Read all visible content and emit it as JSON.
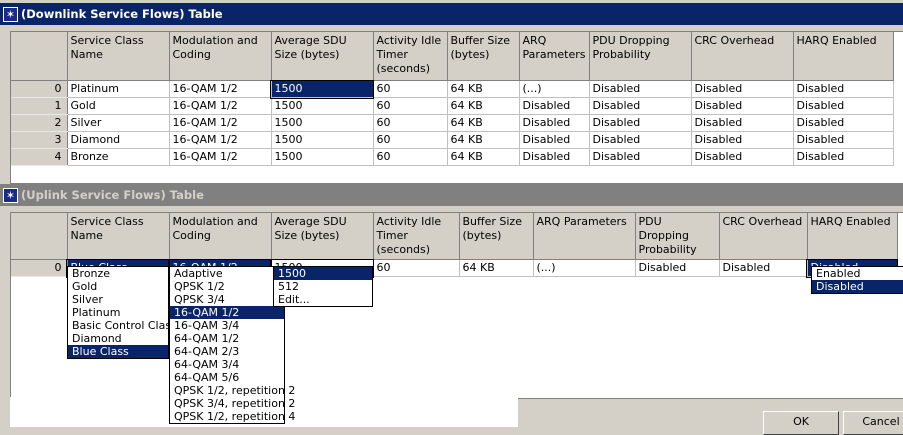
{
  "downlink": {
    "title": "(Downlink Service Flows) Table",
    "columns": [
      "Service Class Name",
      "Modulation and Coding",
      "Average SDU Size (bytes)",
      "Activity Idle Timer (seconds)",
      "Buffer Size (bytes)",
      "ARQ Parameters",
      "PDU Dropping Probability",
      "CRC Overhead",
      "HARQ Enabled"
    ],
    "rows": [
      {
        "index": "0",
        "cells": [
          "Platinum",
          "16-QAM 1/2",
          "1500",
          "60",
          "64 KB",
          "(...)",
          "Disabled",
          "Disabled",
          "Disabled"
        ]
      },
      {
        "index": "1",
        "cells": [
          "Gold",
          "16-QAM 1/2",
          "1500",
          "60",
          "64 KB",
          "Disabled",
          "Disabled",
          "Disabled",
          "Disabled"
        ]
      },
      {
        "index": "2",
        "cells": [
          "Silver",
          "16-QAM 1/2",
          "1500",
          "60",
          "64 KB",
          "Disabled",
          "Disabled",
          "Disabled",
          "Disabled"
        ]
      },
      {
        "index": "3",
        "cells": [
          "Diamond",
          "16-QAM 1/2",
          "1500",
          "60",
          "64 KB",
          "Disabled",
          "Disabled",
          "Disabled",
          "Disabled"
        ]
      },
      {
        "index": "4",
        "cells": [
          "Bronze",
          "16-QAM 1/2",
          "1500",
          "60",
          "64 KB",
          "Disabled",
          "Disabled",
          "Disabled",
          "Disabled"
        ]
      }
    ]
  },
  "uplink": {
    "title": "(Uplink Service Flows) Table",
    "columns": [
      "Service Class Name",
      "Modulation and Coding",
      "Average SDU Size (bytes)",
      "Activity Idle Timer (seconds)",
      "Buffer Size (bytes)",
      "ARQ Parameters",
      "PDU Dropping Probability",
      "CRC Overhead",
      "HARQ Enabled"
    ],
    "rows": [
      {
        "index": "0",
        "cells": [
          "Blue Class",
          "16-QAM 1/2",
          "1500",
          "60",
          "64 KB",
          "(...)",
          "Disabled",
          "Disabled",
          "Disabled"
        ]
      }
    ]
  },
  "dropdowns": {
    "service_class": [
      "Bronze",
      "Gold",
      "Silver",
      "Platinum",
      "Basic Control Class",
      "Diamond",
      "Blue Class"
    ],
    "service_class_selected": "Blue Class",
    "modulation": [
      "Adaptive",
      "QPSK 1/2",
      "QPSK 3/4",
      "16-QAM 1/2",
      "16-QAM 3/4",
      "64-QAM 1/2",
      "64-QAM 2/3",
      "64-QAM 3/4",
      "64-QAM 5/6",
      "QPSK 1/2, repetition 2",
      "QPSK 3/4, repetition 2",
      "QPSK 1/2, repetition 4"
    ],
    "modulation_selected": "16-QAM 1/2",
    "sdu_size": [
      "1500",
      "512",
      "Edit..."
    ],
    "sdu_size_selected": "1500",
    "harq": [
      "Enabled",
      "Disabled"
    ],
    "harq_selected": "Disabled"
  },
  "buttons": {
    "ok": "OK",
    "cancel": "Cancel"
  },
  "colors": {
    "title_active": "#0a246a",
    "title_inactive": "#808080",
    "selection": "#0a246a",
    "face": "#d4d0c8"
  },
  "icons": {
    "window": "star-window-icon"
  }
}
